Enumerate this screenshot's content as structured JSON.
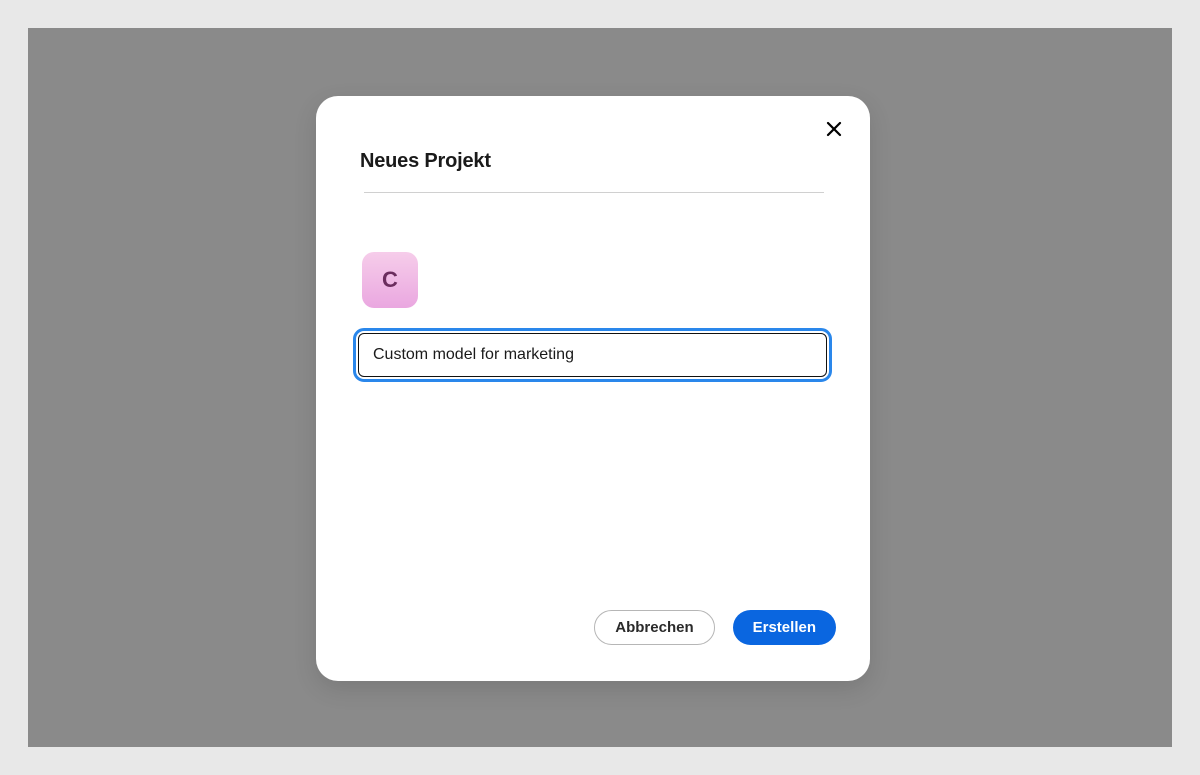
{
  "dialog": {
    "title": "Neues Projekt",
    "icon_letter": "C",
    "name_value": "Custom model for marketing",
    "cancel_label": "Abbrechen",
    "create_label": "Erstellen"
  }
}
